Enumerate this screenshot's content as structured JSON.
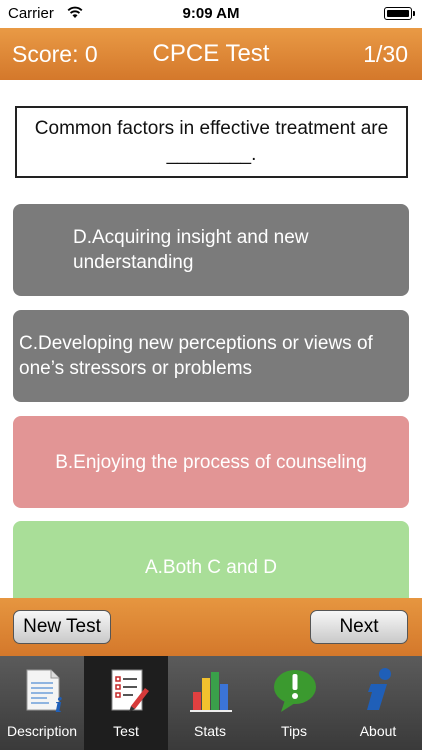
{
  "status_bar": {
    "carrier": "Carrier",
    "time": "9:09 AM"
  },
  "header": {
    "score": "Score: 0",
    "title": "CPCE Test",
    "counter": "1/30",
    "color": "#e08a38"
  },
  "question": {
    "text": "Common factors in effective treatment are ________."
  },
  "answers": [
    {
      "label": "D.Acquiring insight and new understanding",
      "state": "neutral",
      "color": "#7b7b7b"
    },
    {
      "label": "C.Developing new perceptions or views of one’s stressors or problems",
      "state": "neutral",
      "color": "#7b7b7b"
    },
    {
      "label": "B.Enjoying the process of counseling",
      "state": "incorrect",
      "color": "#e29595"
    },
    {
      "label": "A.Both C and D",
      "state": "correct",
      "color": "#a9de98"
    }
  ],
  "actions": {
    "new_test": "New Test",
    "next": "Next"
  },
  "tabs": [
    {
      "label": "Description",
      "icon": "description-icon",
      "active": false
    },
    {
      "label": "Test",
      "icon": "test-checklist-icon",
      "active": true
    },
    {
      "label": "Stats",
      "icon": "stats-bar-chart-icon",
      "active": false
    },
    {
      "label": "Tips",
      "icon": "tips-speech-bubble-icon",
      "active": false
    },
    {
      "label": "About",
      "icon": "about-info-icon",
      "active": false
    }
  ]
}
